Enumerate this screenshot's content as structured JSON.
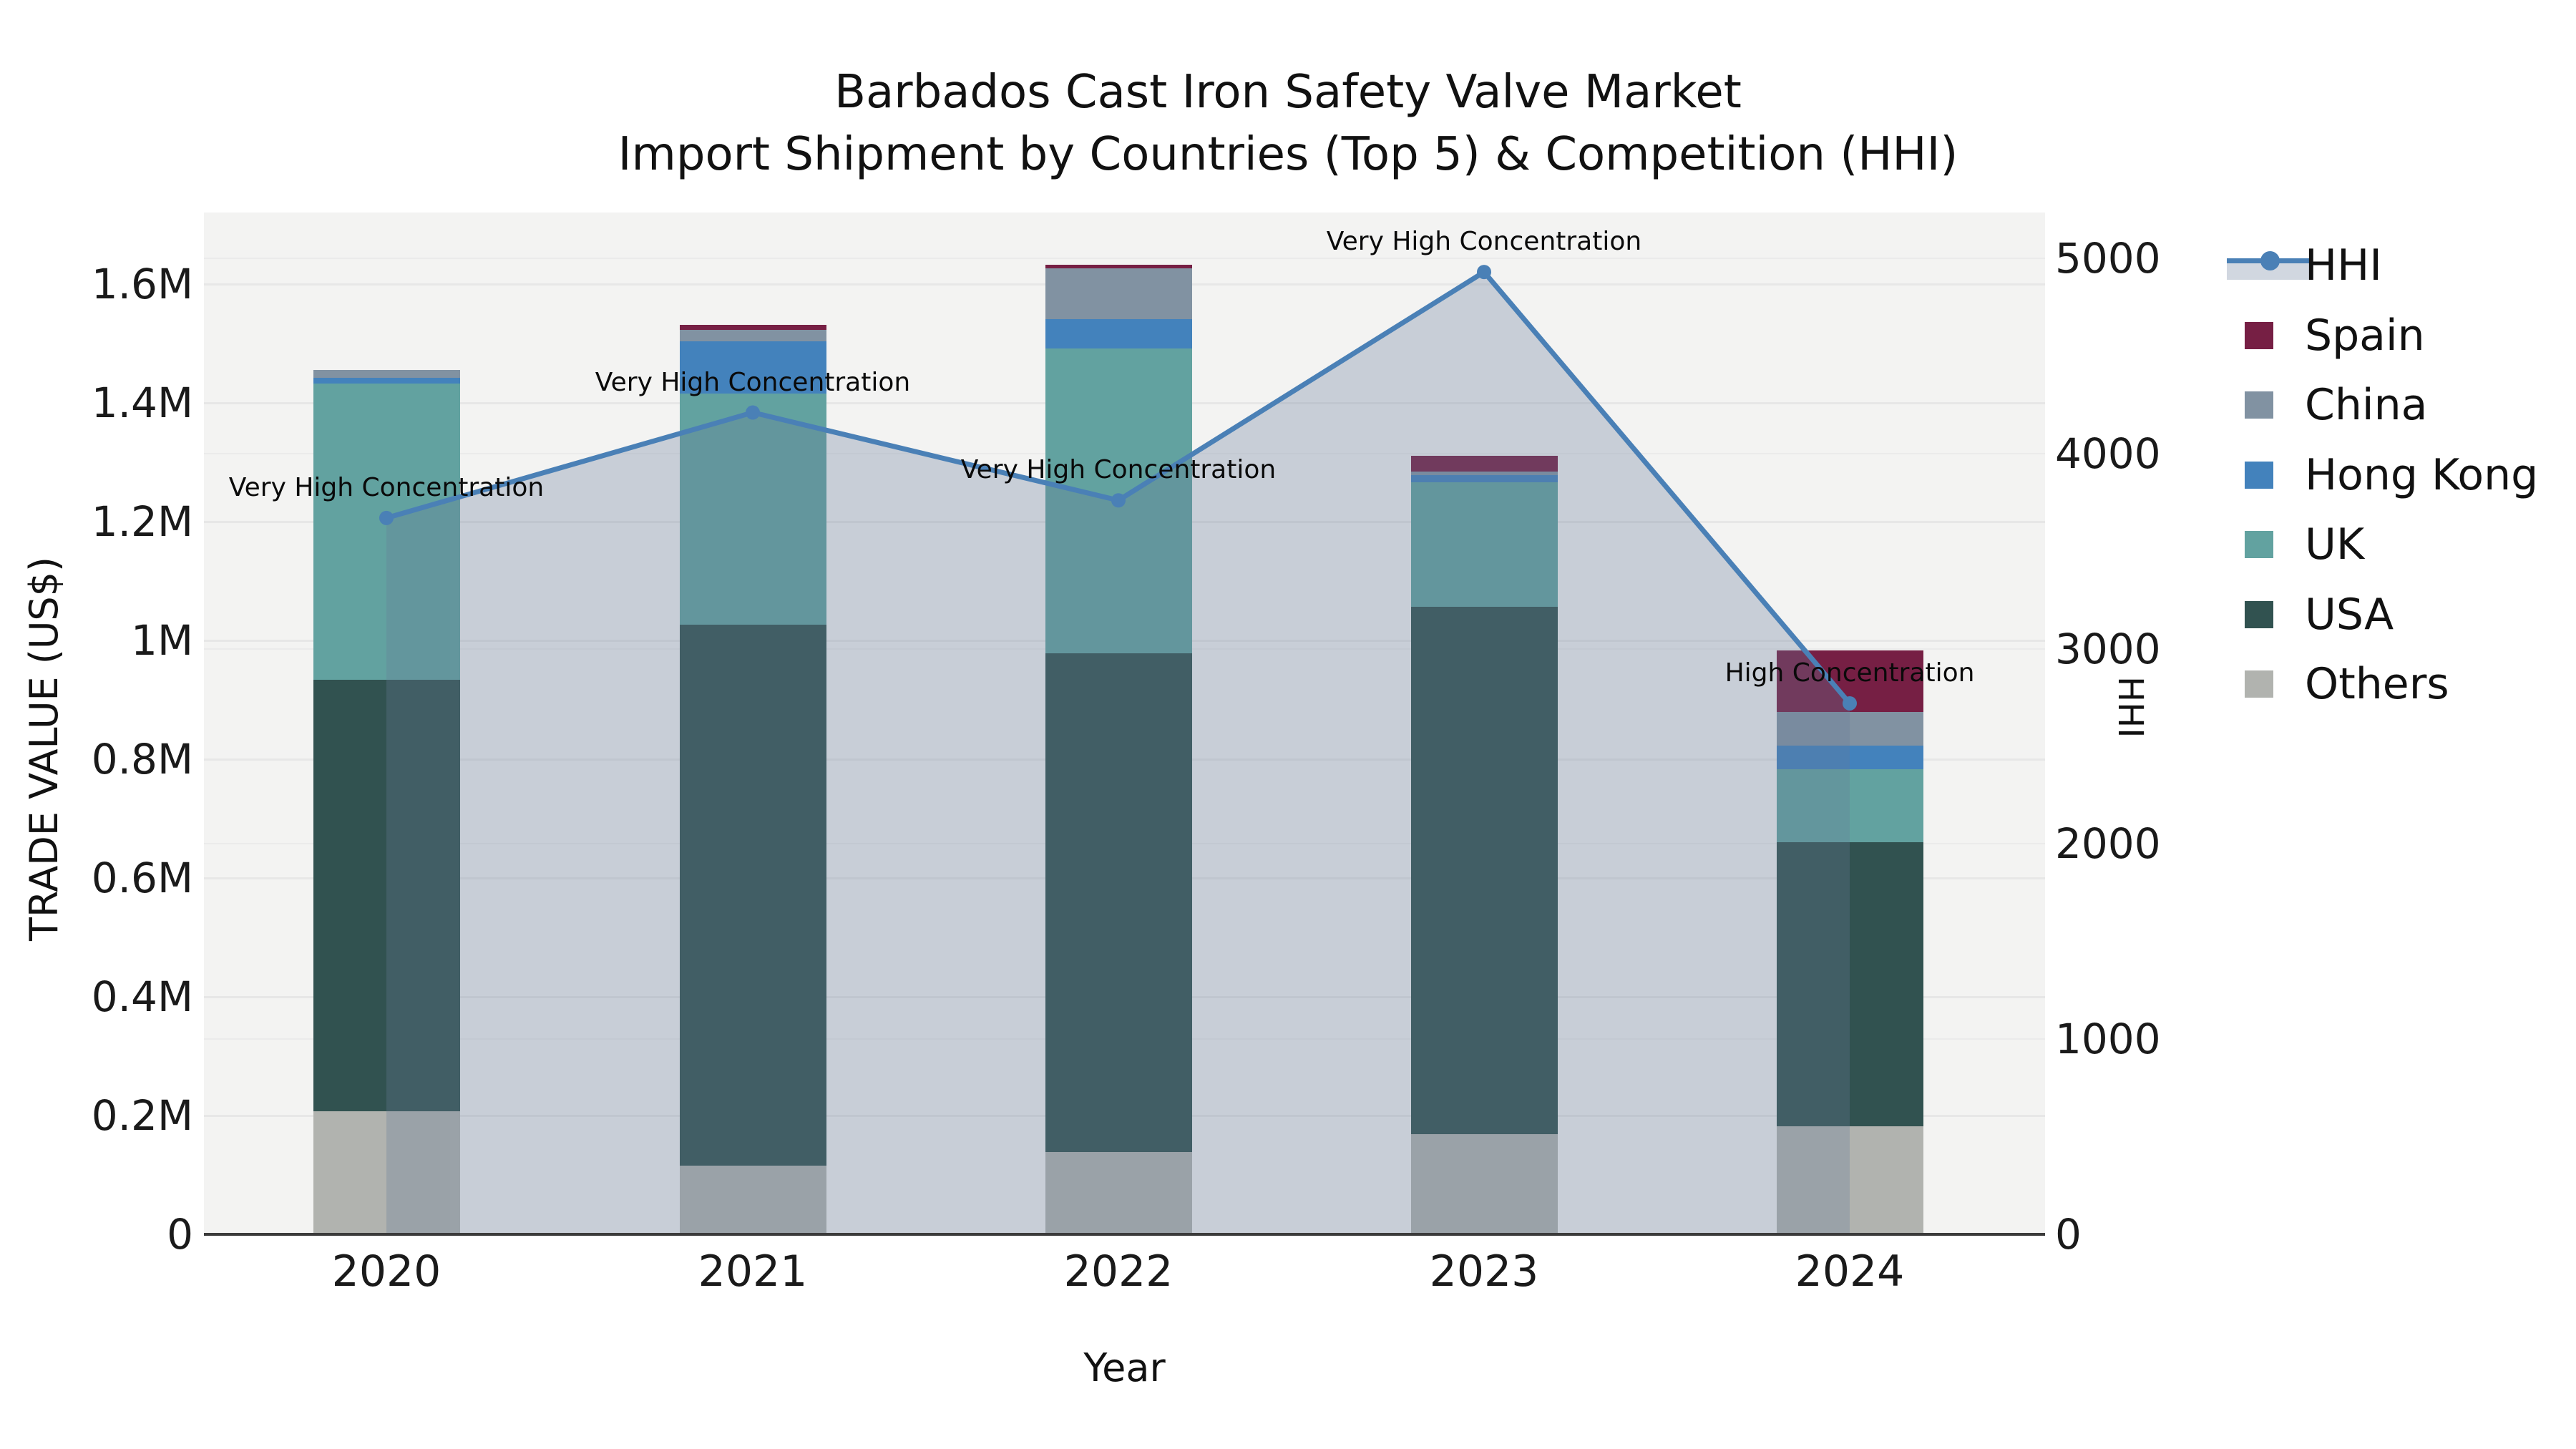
{
  "title": {
    "line1": "Barbados Cast Iron Safety Valve Market",
    "line2": "Import Shipment by Countries (Top 5) & Competition (HHI)"
  },
  "axes": {
    "left": {
      "title": "TRADE VALUE (US$)",
      "ticks": [
        {
          "label": "0",
          "value": 0
        },
        {
          "label": "0.2M",
          "value": 200000
        },
        {
          "label": "0.4M",
          "value": 400000
        },
        {
          "label": "0.6M",
          "value": 600000
        },
        {
          "label": "0.8M",
          "value": 800000
        },
        {
          "label": "1M",
          "value": 1000000
        },
        {
          "label": "1.2M",
          "value": 1200000
        },
        {
          "label": "1.4M",
          "value": 1400000
        },
        {
          "label": "1.6M",
          "value": 1600000
        }
      ]
    },
    "right": {
      "title": "HHI",
      "ticks": [
        {
          "label": "0",
          "value": 0
        },
        {
          "label": "1000",
          "value": 1000
        },
        {
          "label": "2000",
          "value": 2000
        },
        {
          "label": "3000",
          "value": 3000
        },
        {
          "label": "4000",
          "value": 4000
        },
        {
          "label": "5000",
          "value": 5000
        }
      ]
    },
    "x": {
      "title": "Year"
    }
  },
  "colors": {
    "spain": "#761f44",
    "china": "#8192a2",
    "hong_kong": "#4382bc",
    "uk": "#62a2a0",
    "usa": "#315250",
    "others": "#b1b3af",
    "hhi_line": "#4a80b6",
    "hhi_area": "rgba(104,124,152,0.30)",
    "plot_background": "#f3f3f2",
    "axis_line": "#3b3b3b"
  },
  "legend": [
    {
      "label": "HHI",
      "type": "line",
      "color": "#4a80b6"
    },
    {
      "label": "Spain",
      "type": "patch",
      "color": "#761f44"
    },
    {
      "label": "China",
      "type": "patch",
      "color": "#8192a2"
    },
    {
      "label": "Hong Kong",
      "type": "patch",
      "color": "#4382bc"
    },
    {
      "label": "UK",
      "type": "patch",
      "color": "#62a2a0"
    },
    {
      "label": "USA",
      "type": "patch",
      "color": "#315250"
    },
    {
      "label": "Others",
      "type": "patch",
      "color": "#b1b3af"
    }
  ],
  "chart_data": {
    "type": "bar",
    "subtype": "stacked-bars-with-line",
    "title": "Barbados Cast Iron Safety Valve Market — Import Shipment by Countries (Top 5) & Competition (HHI)",
    "xlabel": "Year",
    "ylabel_left": "TRADE VALUE (US$)",
    "ylabel_right": "HHI",
    "ylim_left": [
      0,
      1600000
    ],
    "ylim_right": [
      0,
      5000
    ],
    "grid": true,
    "legend_position": "right",
    "categories": [
      "2020",
      "2021",
      "2022",
      "2023",
      "2024"
    ],
    "stack_order_bottom_to_top": [
      "others",
      "usa",
      "uk",
      "hong_kong",
      "china",
      "spain"
    ],
    "series": [
      {
        "key": "others",
        "name": "Others",
        "values": [
          207000,
          116000,
          139000,
          169000,
          182000
        ]
      },
      {
        "key": "usa",
        "name": "USA",
        "values": [
          727000,
          911000,
          839000,
          888000,
          478000
        ]
      },
      {
        "key": "uk",
        "name": "UK",
        "values": [
          498000,
          389000,
          514000,
          209000,
          123000
        ]
      },
      {
        "key": "hong_kong",
        "name": "Hong Kong",
        "values": [
          10000,
          88000,
          49000,
          12000,
          40000
        ]
      },
      {
        "key": "china",
        "name": "China",
        "values": [
          13000,
          19000,
          86000,
          6000,
          57000
        ]
      },
      {
        "key": "spain",
        "name": "Spain",
        "values": [
          0,
          8000,
          5000,
          27000,
          103000
        ]
      }
    ],
    "bar_totals": [
      1455000,
      1531000,
      1632000,
      1311000,
      983000
    ],
    "line_series": {
      "name": "HHI",
      "values": [
        3670,
        4210,
        3760,
        4930,
        2720
      ],
      "axis": "right",
      "area_fill": true
    },
    "annotations": [
      {
        "category": "2020",
        "text": "Very High Concentration"
      },
      {
        "category": "2021",
        "text": "Very High Concentration"
      },
      {
        "category": "2022",
        "text": "Very High Concentration"
      },
      {
        "category": "2023",
        "text": "Very High Concentration"
      },
      {
        "category": "2024",
        "text": "High Concentration"
      }
    ]
  }
}
